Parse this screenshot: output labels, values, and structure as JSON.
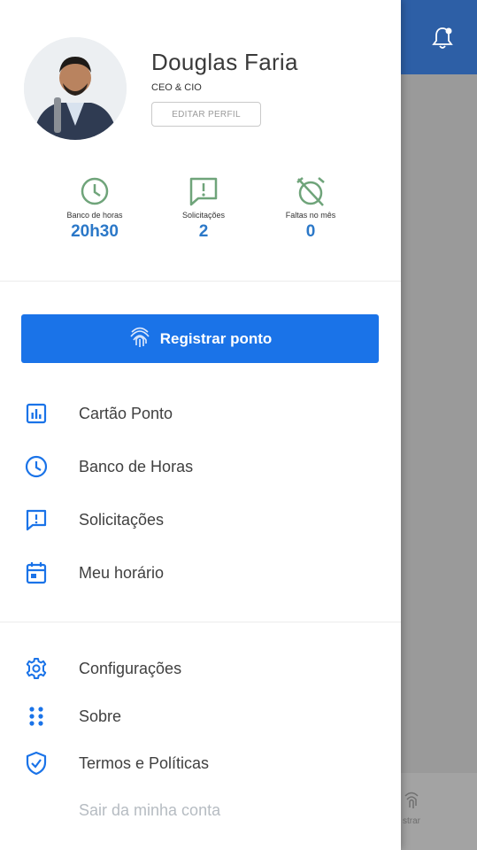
{
  "profile": {
    "name": "Douglas Faria",
    "role": "CEO & CIO",
    "edit_label": "EDITAR PERFIL"
  },
  "stats": [
    {
      "label": "Banco de horas",
      "value": "20h30",
      "icon": "clock-icon"
    },
    {
      "label": "Solicitações",
      "value": "2",
      "icon": "alert-message-icon"
    },
    {
      "label": "Faltas no mês",
      "value": "0",
      "icon": "alarm-off-icon"
    }
  ],
  "register_button": {
    "label": "Registrar ponto",
    "icon": "fingerprint-icon"
  },
  "menu": [
    {
      "label": "Cartão Ponto",
      "icon": "chart-card-icon"
    },
    {
      "label": "Banco de Horas",
      "icon": "clock-icon"
    },
    {
      "label": "Solicitações",
      "icon": "alert-message-icon"
    },
    {
      "label": "Meu horário",
      "icon": "calendar-icon"
    }
  ],
  "secondary_menu": [
    {
      "label": "Configurações",
      "icon": "gear-icon"
    },
    {
      "label": "Sobre",
      "icon": "dots-grid-icon"
    },
    {
      "label": "Termos e Políticas",
      "icon": "shield-check-icon"
    }
  ],
  "logout_label": "Sair da minha conta",
  "background_app": {
    "bottom_item_label": "strar"
  },
  "colors": {
    "accent": "#1a73e8",
    "stat_value": "#2b78c8",
    "header": "#2d5fa6",
    "stat_icon": "#6fa47a"
  }
}
